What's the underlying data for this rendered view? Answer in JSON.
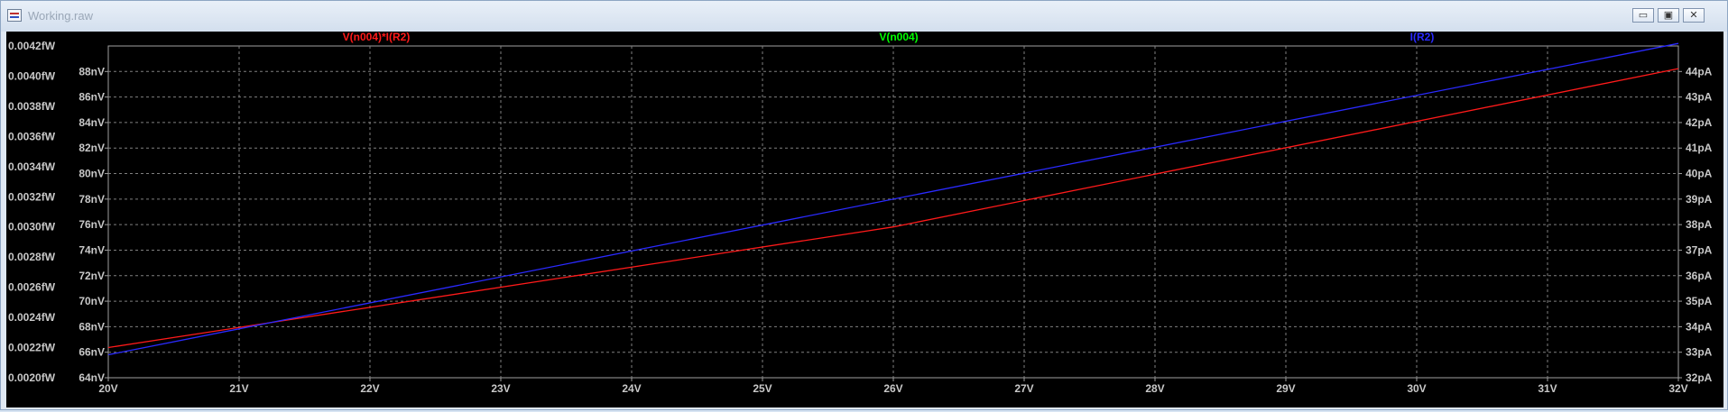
{
  "window": {
    "title": "Working.raw",
    "controls": [
      "▭",
      "▣",
      "✕"
    ]
  },
  "colors": {
    "background": "#000000",
    "grid": "#808080",
    "tick_text": "#c8c8c8",
    "red": "#ff1a1a",
    "green": "#00ff00",
    "blue": "#2a2aff"
  },
  "chart_data": {
    "type": "line",
    "x": {
      "range": [
        20,
        32
      ],
      "ticks": [
        20,
        21,
        22,
        23,
        24,
        25,
        26,
        27,
        28,
        29,
        30,
        31,
        32
      ],
      "tick_labels": [
        "20V",
        "21V",
        "22V",
        "23V",
        "24V",
        "25V",
        "26V",
        "27V",
        "28V",
        "29V",
        "30V",
        "31V",
        "32V"
      ]
    },
    "left_outer_axis": {
      "range": [
        0.002,
        0.0042
      ],
      "ticks": [
        0.002,
        0.0022,
        0.0024,
        0.0026,
        0.0028,
        0.003,
        0.0032,
        0.0034,
        0.0036,
        0.0038,
        0.004,
        0.0042
      ],
      "tick_labels": [
        "0.0020fW",
        "0.0022fW",
        "0.0024fW",
        "0.0026fW",
        "0.0028fW",
        "0.0030fW",
        "0.0032fW",
        "0.0034fW",
        "0.0036fW",
        "0.0038fW",
        "0.0040fW",
        "0.0042fW"
      ]
    },
    "left_inner_axis": {
      "range": [
        64,
        90
      ],
      "ticks": [
        64,
        66,
        68,
        70,
        72,
        74,
        76,
        78,
        80,
        82,
        84,
        86,
        88
      ],
      "tick_labels": [
        "64nV",
        "66nV",
        "68nV",
        "70nV",
        "72nV",
        "74nV",
        "76nV",
        "78nV",
        "80nV",
        "82nV",
        "84nV",
        "86nV",
        "88nV"
      ]
    },
    "right_axis": {
      "range": [
        32,
        45
      ],
      "ticks": [
        32,
        33,
        34,
        35,
        36,
        37,
        38,
        39,
        40,
        41,
        42,
        43,
        44
      ],
      "tick_labels": [
        "32pA",
        "33pA",
        "34pA",
        "35pA",
        "36pA",
        "37pA",
        "38pA",
        "39pA",
        "40pA",
        "41pA",
        "42pA",
        "43pA",
        "44pA"
      ]
    },
    "grid": true,
    "series": [
      {
        "name": "V(n004)*I(R2)",
        "color": "#ff1a1a",
        "axis": "left_outer_axis",
        "x": [
          20,
          26,
          32
        ],
        "y": [
          0.0022,
          0.003,
          0.00405
        ]
      },
      {
        "name": "V(n004)",
        "color": "#00ff00",
        "axis": "left_inner_axis",
        "x": [
          20,
          32
        ],
        "y": [
          null,
          null
        ]
      },
      {
        "name": "I(R2)",
        "color": "#2a2aff",
        "axis": "right_axis",
        "x": [
          20,
          32
        ],
        "y": [
          32.9,
          45.1
        ]
      }
    ]
  }
}
